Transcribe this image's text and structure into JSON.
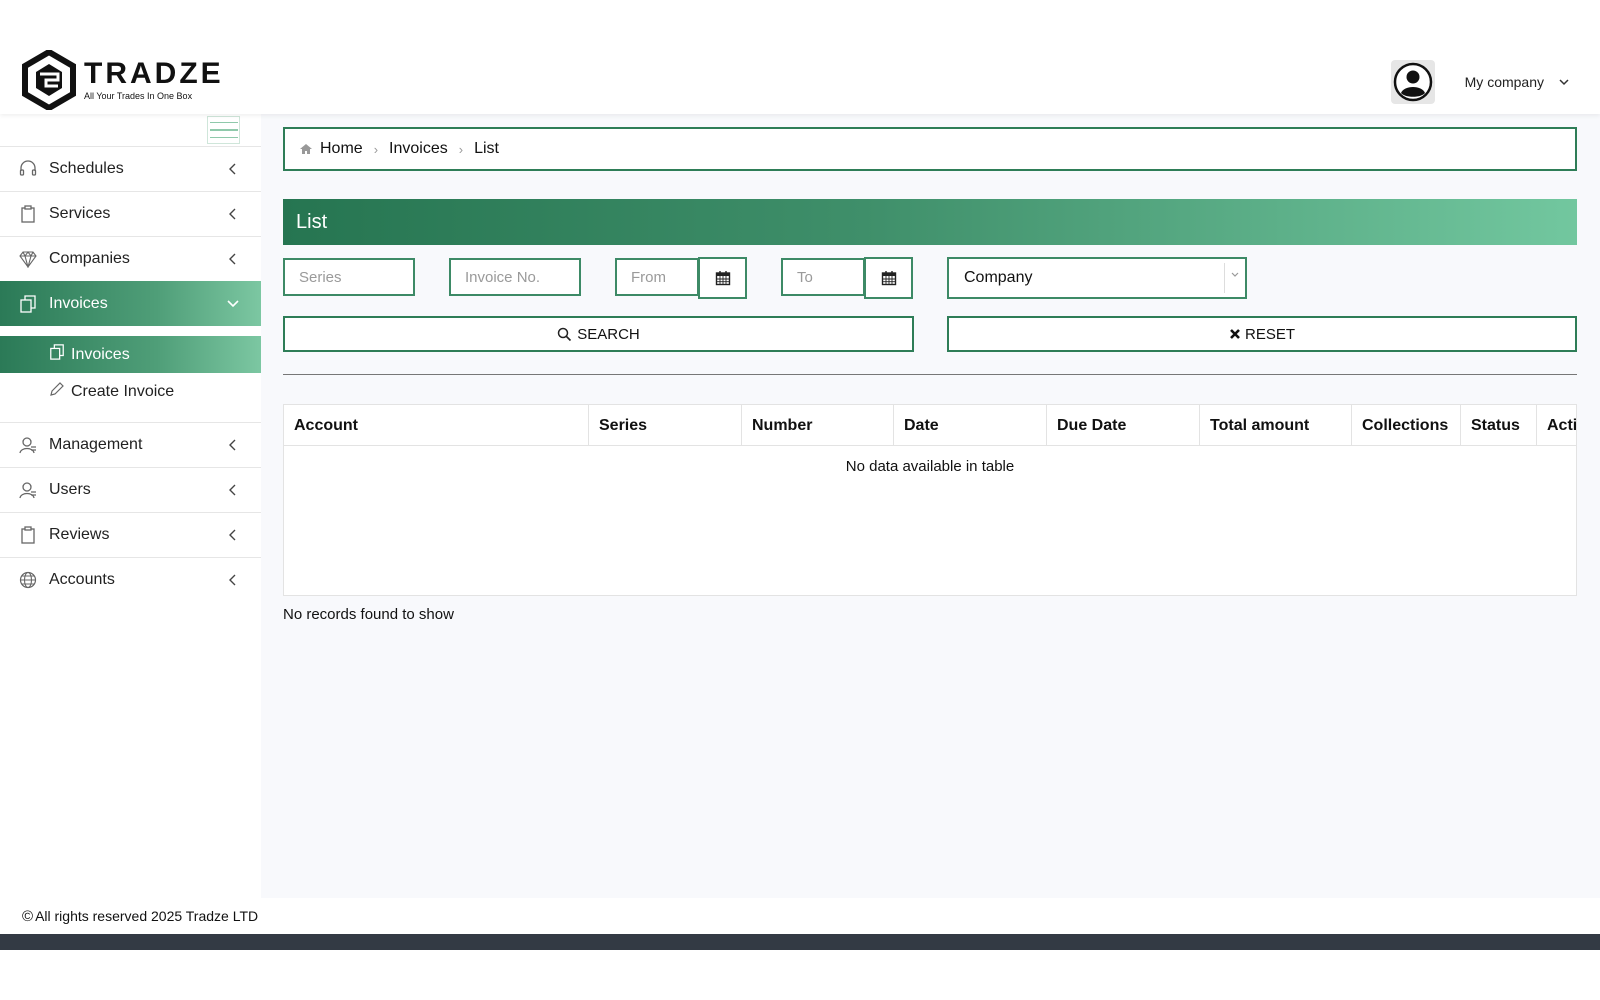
{
  "brand": {
    "name": "TRADZE",
    "tagline": "All Your Trades In One Box"
  },
  "header": {
    "company_label": "My company"
  },
  "sidebar": {
    "items": [
      {
        "label": "Schedules",
        "icon": "headset-icon"
      },
      {
        "label": "Services",
        "icon": "clipboard-icon"
      },
      {
        "label": "Companies",
        "icon": "diamond-icon"
      },
      {
        "label": "Invoices",
        "icon": "documents-icon",
        "expanded": true
      },
      {
        "label": "Management",
        "icon": "user-icon"
      },
      {
        "label": "Users",
        "icon": "user-icon"
      },
      {
        "label": "Reviews",
        "icon": "clipboard-icon"
      },
      {
        "label": "Accounts",
        "icon": "globe-icon"
      }
    ],
    "submenu": [
      {
        "label": "Invoices",
        "icon": "documents-icon",
        "active": true
      },
      {
        "label": "Create Invoice",
        "icon": "pencil-icon"
      }
    ]
  },
  "breadcrumb": {
    "home": "Home",
    "section": "Invoices",
    "current": "List"
  },
  "panel": {
    "title": "List"
  },
  "filters": {
    "series_placeholder": "Series",
    "invoice_no_placeholder": "Invoice No.",
    "from_placeholder": "From",
    "to_placeholder": "To",
    "company_selected": "Company"
  },
  "buttons": {
    "search": "SEARCH",
    "reset": "RESET"
  },
  "table": {
    "columns": [
      "Account",
      "Series",
      "Number",
      "Date",
      "Due Date",
      "Total amount",
      "Collections",
      "Status",
      "Acti"
    ],
    "empty_message": "No data available in table"
  },
  "records_note": "No records found to show",
  "footer": {
    "copyright_symbol": "©",
    "text": "All rights reserved 2025 Tradze LTD"
  },
  "colors": {
    "accent": "#2e7d57",
    "accent_light": "#72c79f",
    "bottom_bar": "#333a44"
  }
}
